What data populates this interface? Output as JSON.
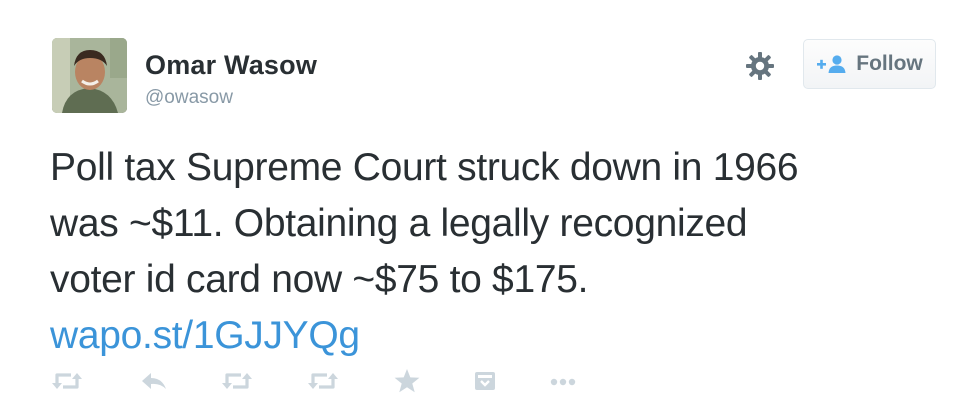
{
  "tweet": {
    "author": {
      "name": "Omar Wasow",
      "handle": "@owasow",
      "avatar_icon": "user-avatar-photo"
    },
    "follow_button": {
      "label": "Follow",
      "icon": "add-user-icon"
    },
    "settings_icon": "gear-icon",
    "text_lines": [
      "Poll tax Supreme Court struck down in 1966",
      "was ~$11. Obtaining a legally recognized",
      "voter id card now ~$75 to $175."
    ],
    "link": "wapo.st/1GJJYQg",
    "actions": [
      {
        "name": "retweeted-icon"
      },
      {
        "name": "reply-icon"
      },
      {
        "name": "retweet-icon"
      },
      {
        "name": "retweet-icon"
      },
      {
        "name": "favorite-icon"
      },
      {
        "name": "embed-icon"
      },
      {
        "name": "more-icon"
      }
    ],
    "colors": {
      "text": "#292f33",
      "muted": "#8899a6",
      "link": "#3b94d9",
      "action_icon": "#ccd6dd"
    }
  }
}
